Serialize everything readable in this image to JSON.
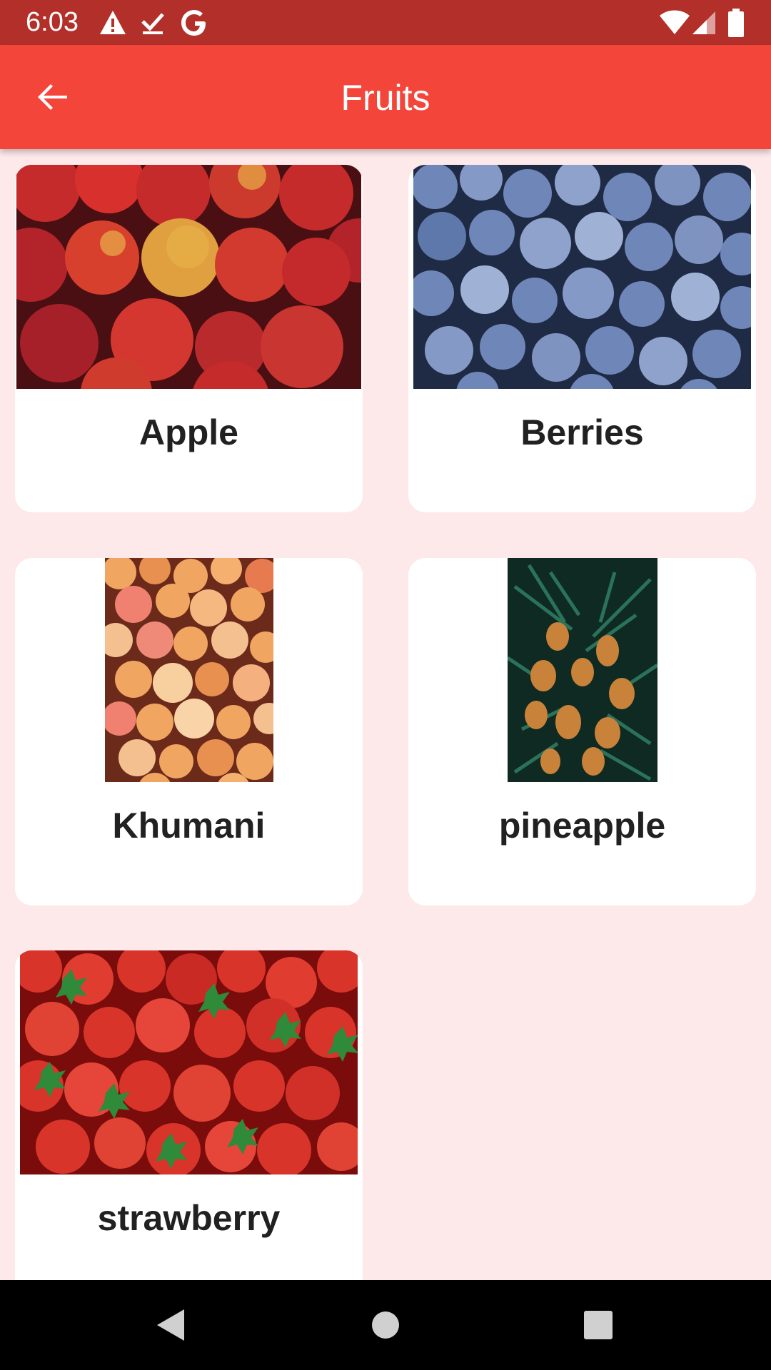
{
  "status_bar": {
    "time": "6:03",
    "icons": [
      "warning-icon",
      "download-done-icon",
      "google-icon",
      "wifi-icon",
      "signal-icon",
      "battery-icon"
    ]
  },
  "app_bar": {
    "title": "Fruits",
    "back_icon": "arrow-back-icon",
    "color": "#f3453a"
  },
  "fruits": [
    {
      "label": "Apple"
    },
    {
      "label": "Berries"
    },
    {
      "label": "Khumani"
    },
    {
      "label": "pineapple"
    },
    {
      "label": "strawberry"
    }
  ],
  "nav_bar": {
    "icons": [
      "back-triangle-icon",
      "home-circle-icon",
      "recents-square-icon"
    ]
  },
  "colors": {
    "status_bar": "#b3302a",
    "background": "#fde8ea",
    "card": "#ffffff",
    "text": "#212121"
  }
}
